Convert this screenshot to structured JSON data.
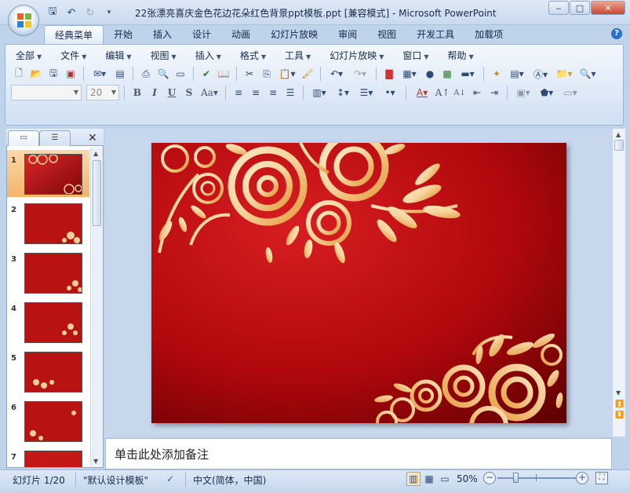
{
  "window": {
    "title": "22张漂亮喜庆金色花边花朵红色背景ppt模板.ppt [兼容模式] - Microsoft PowerPoint"
  },
  "ribbon_tabs": [
    "经典菜单",
    "开始",
    "插入",
    "设计",
    "动画",
    "幻灯片放映",
    "审阅",
    "视图",
    "开发工具",
    "加载项"
  ],
  "menus": [
    "全部",
    "文件",
    "编辑",
    "视图",
    "插入",
    "格式",
    "工具",
    "幻灯片放映",
    "窗口",
    "帮助"
  ],
  "font_box": {
    "font": "",
    "size": "20"
  },
  "slides": [
    {
      "number": "1",
      "selected": true
    },
    {
      "number": "2"
    },
    {
      "number": "3"
    },
    {
      "number": "4"
    },
    {
      "number": "5"
    },
    {
      "number": "6"
    },
    {
      "number": "7"
    }
  ],
  "notes": {
    "placeholder": "单击此处添加备注"
  },
  "status": {
    "slide_info": "幻灯片 1/20",
    "theme": "\"默认设计模板\"",
    "language": "中文(简体，中国)",
    "zoom": "50%"
  },
  "colors": {
    "slide_red": "#c81a1a",
    "slide_dark_red": "#6e0000",
    "gold": "#f0c98a",
    "selection": "#f4b46b"
  }
}
